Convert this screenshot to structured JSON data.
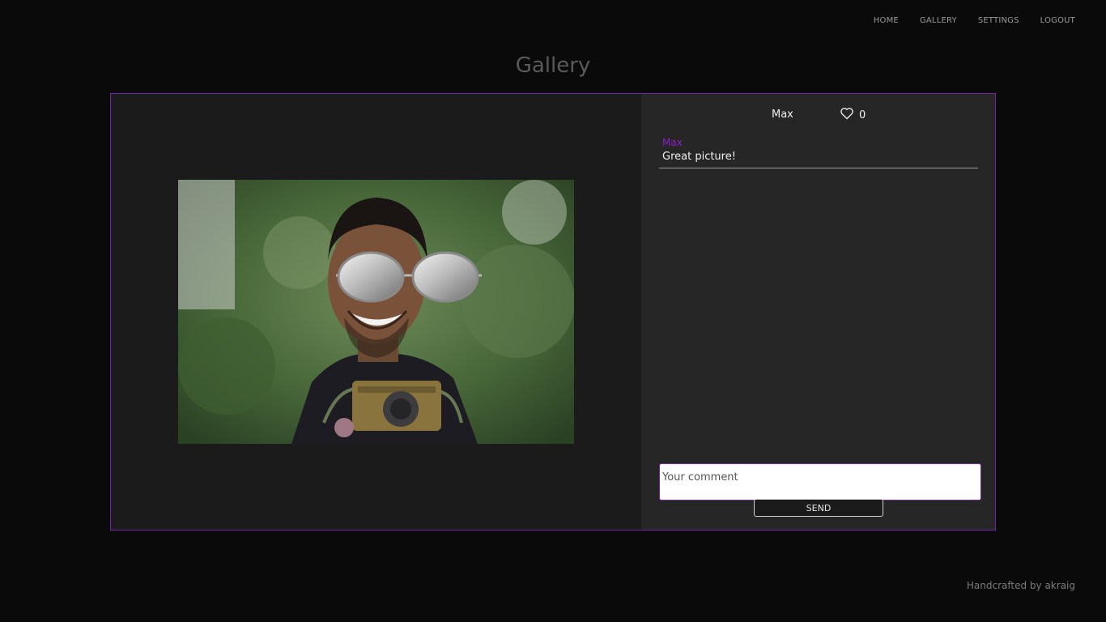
{
  "nav": {
    "items": [
      "HOME",
      "GALLERY",
      "SETTINGS",
      "LOGOUT"
    ]
  },
  "page_title": "Gallery",
  "post": {
    "author": "Max",
    "likes": "0",
    "like_icon": "heart-outline-icon",
    "image_description": "photo with sunglasses and camera stickers"
  },
  "comments": [
    {
      "author": "Max",
      "text": "Great picture!"
    }
  ],
  "comment_form": {
    "placeholder": "Your comment",
    "value": "",
    "send_label": "SEND"
  },
  "footer": {
    "text": "Handcrafted by akraig"
  },
  "colors": {
    "accent": "#7b1fb0",
    "comment_author": "#8e1cc7",
    "background": "#0a0a0a",
    "panel": "#262626"
  }
}
